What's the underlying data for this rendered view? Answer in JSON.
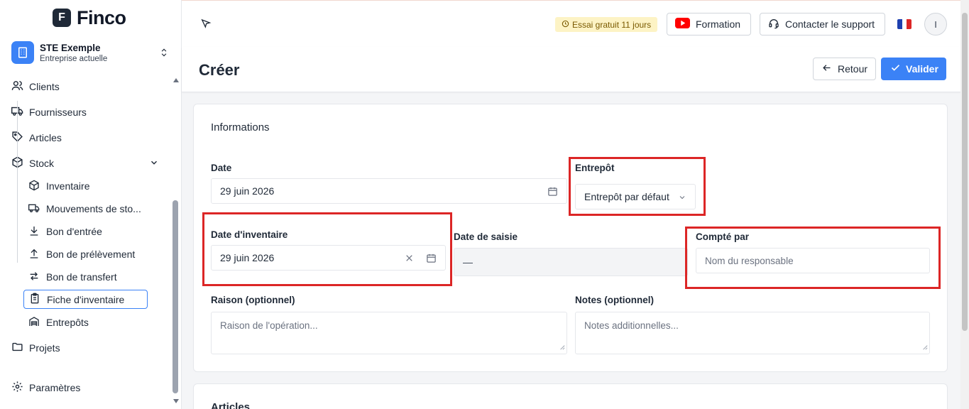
{
  "brand": {
    "logo_letter": "F",
    "name": "Finco"
  },
  "company": {
    "name": "STE Exemple",
    "subtitle": "Entreprise actuelle"
  },
  "sidebar": {
    "items": [
      {
        "label": "Clients",
        "icon": "users-icon"
      },
      {
        "label": "Fournisseurs",
        "icon": "truck-icon"
      },
      {
        "label": "Articles",
        "icon": "tag-icon"
      },
      {
        "label": "Stock",
        "icon": "box-icon"
      },
      {
        "label": "Projets",
        "icon": "folder-icon"
      },
      {
        "label": "Paramètres",
        "icon": "gear-icon"
      }
    ],
    "stock_children": [
      {
        "label": "Inventaire",
        "icon": "box-icon"
      },
      {
        "label": "Mouvements de sto...",
        "icon": "truck-icon"
      },
      {
        "label": "Bon d'entrée",
        "icon": "arrow-down-icon"
      },
      {
        "label": "Bon de prélèvement",
        "icon": "arrow-up-icon"
      },
      {
        "label": "Bon de transfert",
        "icon": "transfer-icon"
      },
      {
        "label": "Fiche d'inventaire",
        "icon": "clipboard-icon"
      },
      {
        "label": "Entrepôts",
        "icon": "warehouse-icon"
      }
    ]
  },
  "topbar": {
    "trial": "Essai gratuit 11 jours",
    "training": "Formation",
    "support": "Contacter le support",
    "avatar_initial": "I"
  },
  "page": {
    "title": "Créer",
    "back_label": "Retour",
    "submit_label": "Valider"
  },
  "form": {
    "section_title": "Informations",
    "date": {
      "label": "Date",
      "value": "29 juin 2026"
    },
    "warehouse": {
      "label": "Entrepôt",
      "value": "Entrepôt par défaut"
    },
    "inventory_date": {
      "label": "Date d'inventaire",
      "value": "29 juin 2026"
    },
    "entry_date": {
      "label": "Date de saisie",
      "value": "—"
    },
    "counted_by": {
      "label": "Compté par",
      "placeholder": "Nom du responsable"
    },
    "reason": {
      "label": "Raison (optionnel)",
      "placeholder": "Raison de l'opération..."
    },
    "notes": {
      "label": "Notes (optionnel)",
      "placeholder": "Notes additionnelles..."
    }
  },
  "articles_section": {
    "title": "Articles"
  },
  "colors": {
    "accent": "#3b82f6",
    "highlight": "#dc2626",
    "trial_bg": "#fdf3c5"
  }
}
